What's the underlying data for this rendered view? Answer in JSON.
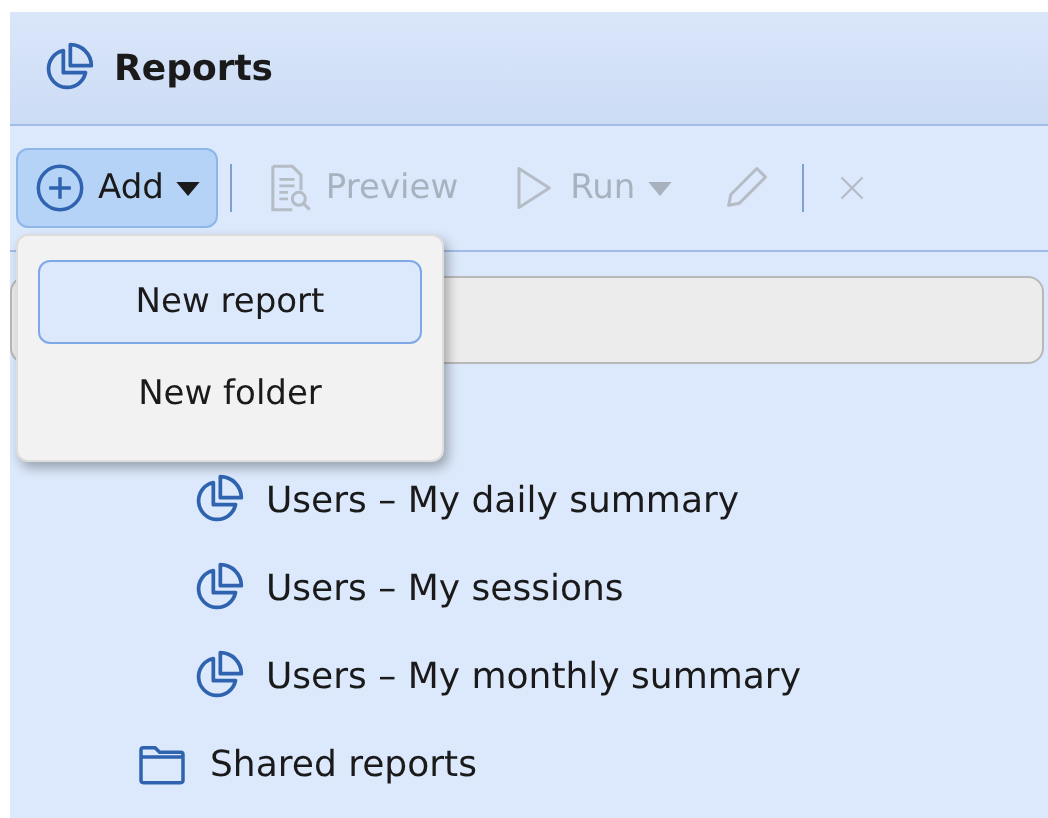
{
  "panel": {
    "title": "Reports"
  },
  "toolbar": [
    {
      "kind": "add",
      "label": "Add",
      "dropdown": true,
      "disabled": false,
      "open": true
    },
    {
      "kind": "preview",
      "label": "Preview",
      "dropdown": false,
      "disabled": true,
      "open": false
    },
    {
      "kind": "run",
      "label": "Run",
      "dropdown": true,
      "disabled": true,
      "open": false
    },
    {
      "kind": "edit",
      "dropdown": false,
      "disabled": true,
      "open": false
    },
    {
      "kind": "delete",
      "dropdown": false,
      "disabled": true,
      "open": false
    }
  ],
  "add_menu": [
    {
      "label": "New report",
      "selected": true
    },
    {
      "label": "New folder",
      "selected": false
    }
  ],
  "tree": [
    {
      "children": [
        {
          "kind": "report",
          "label": "Users – My daily summary"
        },
        {
          "kind": "report",
          "label": "Users – My sessions"
        },
        {
          "kind": "report",
          "label": "Users – My monthly summary"
        }
      ]
    },
    {
      "kind": "folder",
      "label": "Shared reports"
    }
  ]
}
